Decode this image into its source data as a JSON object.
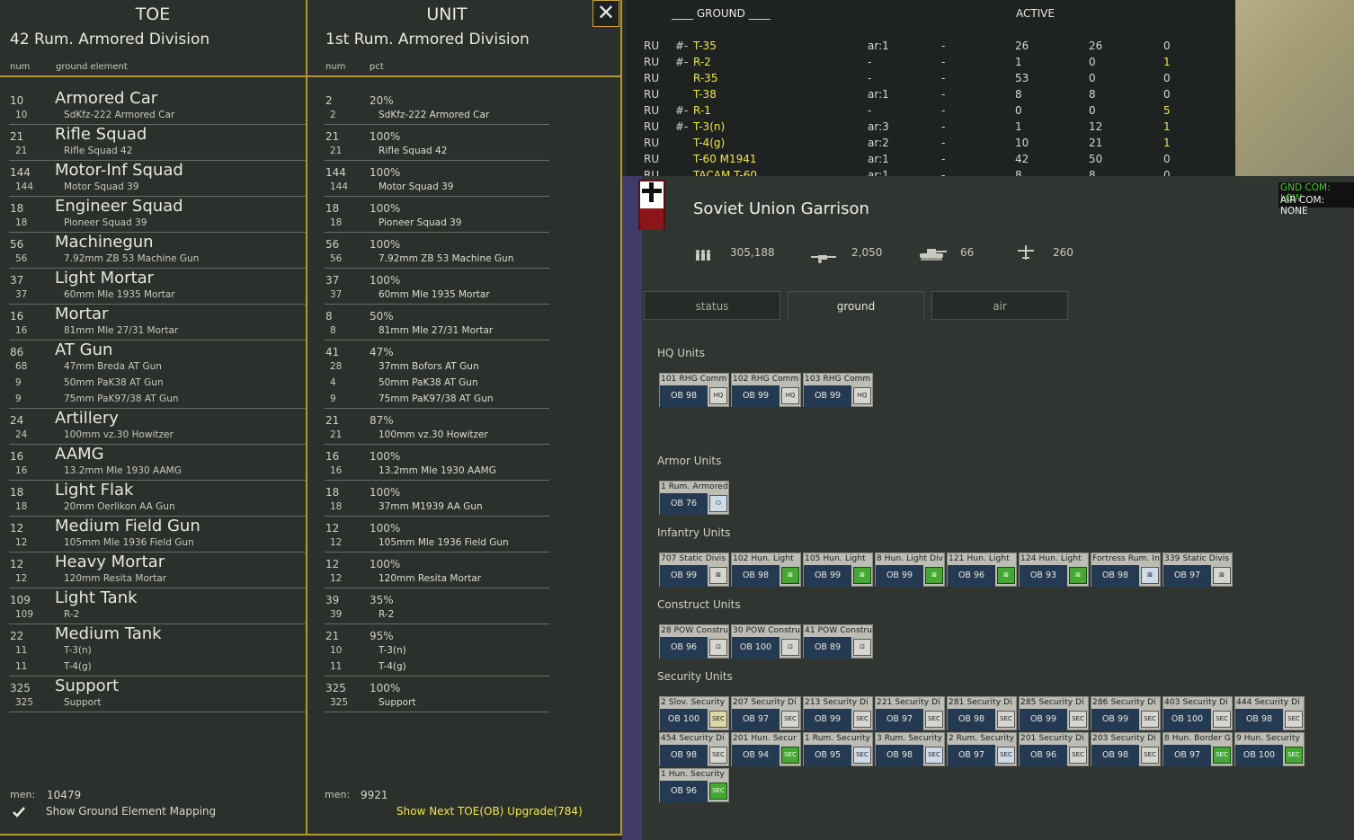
{
  "toe": {
    "col_toe_title": "TOE",
    "toe_name": "42 Rum. Armored Division",
    "col_unit_title": "UNIT",
    "unit_name": "1st Rum. Armored Division",
    "hdr_num": "num",
    "hdr_ground": "ground element",
    "hdr_num2": "num",
    "hdr_pct": "pct",
    "groups": [
      {
        "name": "Armored Car",
        "num": "10",
        "unum": "2",
        "pct": "20%",
        "subs": [
          {
            "n": "10",
            "t": "SdKfz-222 Armored Car",
            "un": "2",
            "ut": "SdKfz-222 Armored Car"
          }
        ]
      },
      {
        "name": "Rifle Squad",
        "num": "21",
        "unum": "21",
        "pct": "100%",
        "subs": [
          {
            "n": "21",
            "t": "Rifle Squad 42",
            "un": "21",
            "ut": "Rifle Squad 42"
          }
        ]
      },
      {
        "name": "Motor-Inf Squad",
        "num": "144",
        "unum": "144",
        "pct": "100%",
        "subs": [
          {
            "n": "144",
            "t": "Motor Squad 39",
            "un": "144",
            "ut": "Motor Squad 39"
          }
        ]
      },
      {
        "name": "Engineer Squad",
        "num": "18",
        "unum": "18",
        "pct": "100%",
        "subs": [
          {
            "n": "18",
            "t": "Pioneer Squad 39",
            "un": "18",
            "ut": "Pioneer Squad 39"
          }
        ]
      },
      {
        "name": "Machinegun",
        "num": "56",
        "unum": "56",
        "pct": "100%",
        "subs": [
          {
            "n": "56",
            "t": "7.92mm ZB 53 Machine Gun",
            "un": "56",
            "ut": "7.92mm ZB 53 Machine Gun"
          }
        ]
      },
      {
        "name": "Light Mortar",
        "num": "37",
        "unum": "37",
        "pct": "100%",
        "subs": [
          {
            "n": "37",
            "t": "60mm Mle 1935 Mortar",
            "un": "37",
            "ut": "60mm Mle 1935 Mortar"
          }
        ]
      },
      {
        "name": "Mortar",
        "num": "16",
        "unum": "8",
        "pct": "50%",
        "subs": [
          {
            "n": "16",
            "t": "81mm Mle 27/31 Mortar",
            "un": "8",
            "ut": "81mm Mle 27/31 Mortar"
          }
        ]
      },
      {
        "name": "AT Gun",
        "num": "86",
        "unum": "41",
        "pct": "47%",
        "subs": [
          {
            "n": "68",
            "t": "47mm Breda AT Gun",
            "un": "28",
            "ut": "37mm Bofors AT Gun"
          },
          {
            "n": "9",
            "t": "50mm PaK38 AT Gun",
            "un": "4",
            "ut": "50mm PaK38 AT Gun"
          },
          {
            "n": "9",
            "t": "75mm PaK97/38 AT Gun",
            "un": "9",
            "ut": "75mm PaK97/38 AT Gun"
          }
        ]
      },
      {
        "name": "Artillery",
        "num": "24",
        "unum": "21",
        "pct": "87%",
        "subs": [
          {
            "n": "24",
            "t": "100mm vz.30 Howitzer",
            "un": "21",
            "ut": "100mm vz.30 Howitzer"
          }
        ]
      },
      {
        "name": "AAMG",
        "num": "16",
        "unum": "16",
        "pct": "100%",
        "subs": [
          {
            "n": "16",
            "t": "13.2mm Mle 1930 AAMG",
            "un": "16",
            "ut": "13.2mm Mle 1930 AAMG"
          }
        ]
      },
      {
        "name": "Light Flak",
        "num": "18",
        "unum": "18",
        "pct": "100%",
        "subs": [
          {
            "n": "18",
            "t": "20mm Oerlikon AA Gun",
            "un": "18",
            "ut": "37mm M1939 AA Gun"
          }
        ]
      },
      {
        "name": "Medium Field Gun",
        "num": "12",
        "unum": "12",
        "pct": "100%",
        "subs": [
          {
            "n": "12",
            "t": "105mm Mle 1936 Field Gun",
            "un": "12",
            "ut": "105mm Mle 1936 Field Gun"
          }
        ]
      },
      {
        "name": "Heavy Mortar",
        "num": "12",
        "unum": "12",
        "pct": "100%",
        "subs": [
          {
            "n": "12",
            "t": "120mm Resita Mortar",
            "un": "12",
            "ut": "120mm Resita Mortar"
          }
        ]
      },
      {
        "name": "Light Tank",
        "num": "109",
        "unum": "39",
        "pct": "35%",
        "subs": [
          {
            "n": "109",
            "t": "R-2",
            "un": "39",
            "ut": "R-2"
          }
        ]
      },
      {
        "name": "Medium Tank",
        "num": "22",
        "unum": "21",
        "pct": "95%",
        "subs": [
          {
            "n": "11",
            "t": "T-3(n)",
            "un": "10",
            "ut": "T-3(n)"
          },
          {
            "n": "11",
            "t": "T-4(g)",
            "un": "11",
            "ut": "T-4(g)"
          }
        ]
      },
      {
        "name": "Support",
        "num": "325",
        "unum": "325",
        "pct": "100%",
        "subs": [
          {
            "n": "325",
            "t": "Support",
            "un": "325",
            "ut": "Support"
          }
        ]
      }
    ],
    "men_label": "men:",
    "toe_men": "10479",
    "unit_men": "9921",
    "show_mapping": "Show Ground Element Mapping",
    "show_next": "Show Next TOE(OB) Upgrade(784)",
    "close_glyph": "✕"
  },
  "ground_table": {
    "title": "____ GROUND ____",
    "active": "ACTIVE",
    "rows": [
      {
        "nat": "RU",
        "mark": "#-",
        "name": "T-35",
        "ar": "ar:1",
        "dash": "-",
        "a": "26",
        "b": "26",
        "c": "0",
        "cy": false
      },
      {
        "nat": "RU",
        "mark": "#-",
        "name": "R-2",
        "ar": "-",
        "dash": "-",
        "a": "1",
        "b": "0",
        "c": "1",
        "cy": true
      },
      {
        "nat": "RU",
        "mark": "",
        "name": "R-35",
        "ar": "-",
        "dash": "-",
        "a": "53",
        "b": "0",
        "c": "0",
        "cy": false
      },
      {
        "nat": "RU",
        "mark": "",
        "name": "T-38",
        "ar": "ar:1",
        "dash": "-",
        "a": "8",
        "b": "8",
        "c": "0",
        "cy": false
      },
      {
        "nat": "RU",
        "mark": "#-",
        "name": "R-1",
        "ar": "-",
        "dash": "-",
        "a": "0",
        "b": "0",
        "c": "5",
        "cy": true
      },
      {
        "nat": "RU",
        "mark": "#-",
        "name": "T-3(n)",
        "ar": "ar:3",
        "dash": "-",
        "a": "1",
        "b": "12",
        "c": "1",
        "cy": true
      },
      {
        "nat": "RU",
        "mark": "",
        "name": "T-4(g)",
        "ar": "ar:2",
        "dash": "-",
        "a": "10",
        "b": "21",
        "c": "1",
        "cy": true
      },
      {
        "nat": "RU",
        "mark": "",
        "name": "T-60 M1941",
        "ar": "ar:1",
        "dash": "-",
        "a": "42",
        "b": "50",
        "c": "0",
        "cy": false
      },
      {
        "nat": "RU",
        "mark": "",
        "name": "TACAM T-60",
        "ar": "ar:1",
        "dash": "-",
        "a": "8",
        "b": "8",
        "c": "0",
        "cy": false
      }
    ]
  },
  "garrison": {
    "title": "Soviet Union Garrison",
    "men": "305,188",
    "guns": "2,050",
    "tanks": "66",
    "aircraft": "260",
    "tabs": [
      "status",
      "ground",
      "air"
    ],
    "sections": {
      "hq": "HQ Units",
      "armor": "Armor Units",
      "infantry": "Infantry Units",
      "construct": "Construct Units",
      "security": "Security Units"
    },
    "hq_units": [
      {
        "name": "101 RHG Comm",
        "ob": "OB 98",
        "icon": "HQ",
        "style": ""
      },
      {
        "name": "102 RHG Comm",
        "ob": "OB 99",
        "icon": "HQ",
        "style": ""
      },
      {
        "name": "103 RHG Comm",
        "ob": "OB 99",
        "icon": "HQ",
        "style": ""
      }
    ],
    "armor_units": [
      {
        "name": "1 Rum. Armored",
        "ob": "OB 76",
        "icon": "⬭",
        "style": "lb"
      }
    ],
    "infantry_units": [
      {
        "name": "707 Static Divis",
        "ob": "OB 99",
        "icon": "⊠",
        "style": ""
      },
      {
        "name": "102 Hun. Light",
        "ob": "OB 98",
        "icon": "⊠",
        "style": "g"
      },
      {
        "name": "105 Hun. Light",
        "ob": "OB 99",
        "icon": "⊠",
        "style": "g"
      },
      {
        "name": "8 Hun. Light Div",
        "ob": "OB 99",
        "icon": "⊠",
        "style": "g"
      },
      {
        "name": "121 Hun. Light",
        "ob": "OB 96",
        "icon": "⊠",
        "style": "g"
      },
      {
        "name": "124 Hun. Light",
        "ob": "OB 93",
        "icon": "⊠",
        "style": "g"
      },
      {
        "name": "Fortress Rum. In",
        "ob": "OB 98",
        "icon": "⊠",
        "style": "lb"
      },
      {
        "name": "339 Static Divis",
        "ob": "OB 97",
        "icon": "⊠",
        "style": ""
      }
    ],
    "construct_units": [
      {
        "name": "28 POW Constru",
        "ob": "OB 96",
        "icon": "⊡",
        "style": ""
      },
      {
        "name": "30 POW Constru",
        "ob": "OB 100",
        "icon": "⊡",
        "style": ""
      },
      {
        "name": "41 POW Constru",
        "ob": "OB 89",
        "icon": "⊡",
        "style": ""
      }
    ],
    "security_units": [
      {
        "name": "2 Slov. Security",
        "ob": "OB 100",
        "icon": "SEC",
        "style": "y"
      },
      {
        "name": "207 Security Di",
        "ob": "OB 97",
        "icon": "SEC",
        "style": ""
      },
      {
        "name": "213 Security Di",
        "ob": "OB 99",
        "icon": "SEC",
        "style": ""
      },
      {
        "name": "221 Security Di",
        "ob": "OB 97",
        "icon": "SEC",
        "style": ""
      },
      {
        "name": "281 Security Di",
        "ob": "OB 98",
        "icon": "SEC",
        "style": ""
      },
      {
        "name": "285 Security Di",
        "ob": "OB 99",
        "icon": "SEC",
        "style": ""
      },
      {
        "name": "286 Security Di",
        "ob": "OB 99",
        "icon": "SEC",
        "style": ""
      },
      {
        "name": "403 Security Di",
        "ob": "OB 100",
        "icon": "SEC",
        "style": ""
      },
      {
        "name": "444 Security Di",
        "ob": "OB 98",
        "icon": "SEC",
        "style": ""
      },
      {
        "name": "454 Security Di",
        "ob": "OB 98",
        "icon": "SEC",
        "style": ""
      },
      {
        "name": "201 Hun. Secur",
        "ob": "OB 94",
        "icon": "SEC",
        "style": "g"
      },
      {
        "name": "1 Rum. Security",
        "ob": "OB 95",
        "icon": "SEC",
        "style": "lb"
      },
      {
        "name": "3 Rum. Security",
        "ob": "OB 98",
        "icon": "SEC",
        "style": "lb"
      },
      {
        "name": "2 Rum. Security",
        "ob": "OB 97",
        "icon": "SEC",
        "style": "lb"
      },
      {
        "name": "201 Security Di",
        "ob": "OB 96",
        "icon": "SEC",
        "style": ""
      },
      {
        "name": "203 Security Di",
        "ob": "OB 98",
        "icon": "SEC",
        "style": ""
      },
      {
        "name": "8 Hun. Border G",
        "ob": "OB 97",
        "icon": "SEC",
        "style": "g"
      },
      {
        "name": "9 Hun. Security",
        "ob": "OB 100",
        "icon": "SEC",
        "style": "g"
      },
      {
        "name": "1 Hun. Security",
        "ob": "OB 96",
        "icon": "SEC",
        "style": "g"
      }
    ]
  },
  "com_status": {
    "gnd": "GND COM: LOW",
    "air": "AIR COM: NONE"
  },
  "colors": {
    "gold": "#b8952e",
    "yellow_text": "#f2e64a",
    "green_icon": "#45a832",
    "ob_blue": "#243a52"
  }
}
